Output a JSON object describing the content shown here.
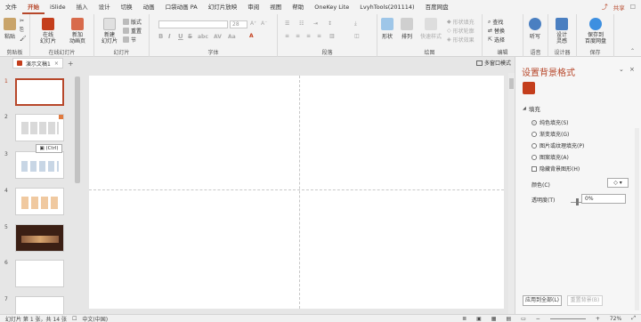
{
  "tabs": [
    "文件",
    "开始",
    "iSlide",
    "插入",
    "设计",
    "切换",
    "动画",
    "口袋动画 PA",
    "幻灯片放映",
    "审阅",
    "视图",
    "帮助",
    "OneKey Lite",
    "LvyhTools(201114)",
    "百度网盘"
  ],
  "share_label": "共享",
  "ribbon": {
    "clipboard": {
      "group": "剪贴板",
      "paste": "粘贴"
    },
    "online_slides": {
      "group": "在线幻灯片",
      "online": "在线\n幻灯片",
      "new_anim": "新加\n动画页"
    },
    "slides": {
      "group": "幻灯片",
      "new_slide": "新建\n幻灯片",
      "layout": "版式",
      "reset": "重置",
      "section": "节"
    },
    "font": {
      "group": "字体",
      "font_field": "",
      "size_field": "28",
      "bold": "B",
      "italic": "I",
      "underline": "U",
      "strike": "S",
      "shadow": "abc",
      "spacing": "AV",
      "case": "Aa"
    },
    "paragraph": {
      "group": "段落"
    },
    "drawing": {
      "group": "绘图",
      "shape": "形状",
      "arrange": "排列",
      "quick_styles": "快速样式",
      "fill": "形状填充",
      "outline": "形状轮廓",
      "effects": "形状效果"
    },
    "editing": {
      "group": "编辑",
      "find": "查找",
      "replace": "替换",
      "select": "选择"
    },
    "voice": {
      "group": "语音",
      "dictate": "听写"
    },
    "designer": {
      "group": "设计器",
      "ideas": "设计\n灵感"
    },
    "save": {
      "group": "保存",
      "save_baidu": "保存到\n百度网盘"
    }
  },
  "doc_tab": "演示文稿1",
  "add_tab": "+",
  "multi_window": "多窗口模式",
  "slide_numbers": [
    "1",
    "2",
    "3",
    "4",
    "5",
    "6",
    "7"
  ],
  "paste_chip": "(Ctrl)",
  "pane": {
    "title": "设置背景格式",
    "fill_section": "填充",
    "options": [
      "纯色填充(S)",
      "渐变填充(G)",
      "图片或纹理填充(P)",
      "图案填充(A)"
    ],
    "hide_bg": "隐藏背景图形(H)",
    "color_label": "颜色(C)",
    "transparency_label": "透明度(T)",
    "transparency_value": "0%",
    "apply_all": "应用到全部(L)",
    "reset_bg": "重置背景(B)"
  },
  "status": {
    "slide_info": "幻灯片 第 1 张，共 14 张",
    "language": "中文(中国)",
    "zoom": "72%"
  },
  "colors": {
    "accent": "#b7472a",
    "brand": "#c43e1c"
  }
}
